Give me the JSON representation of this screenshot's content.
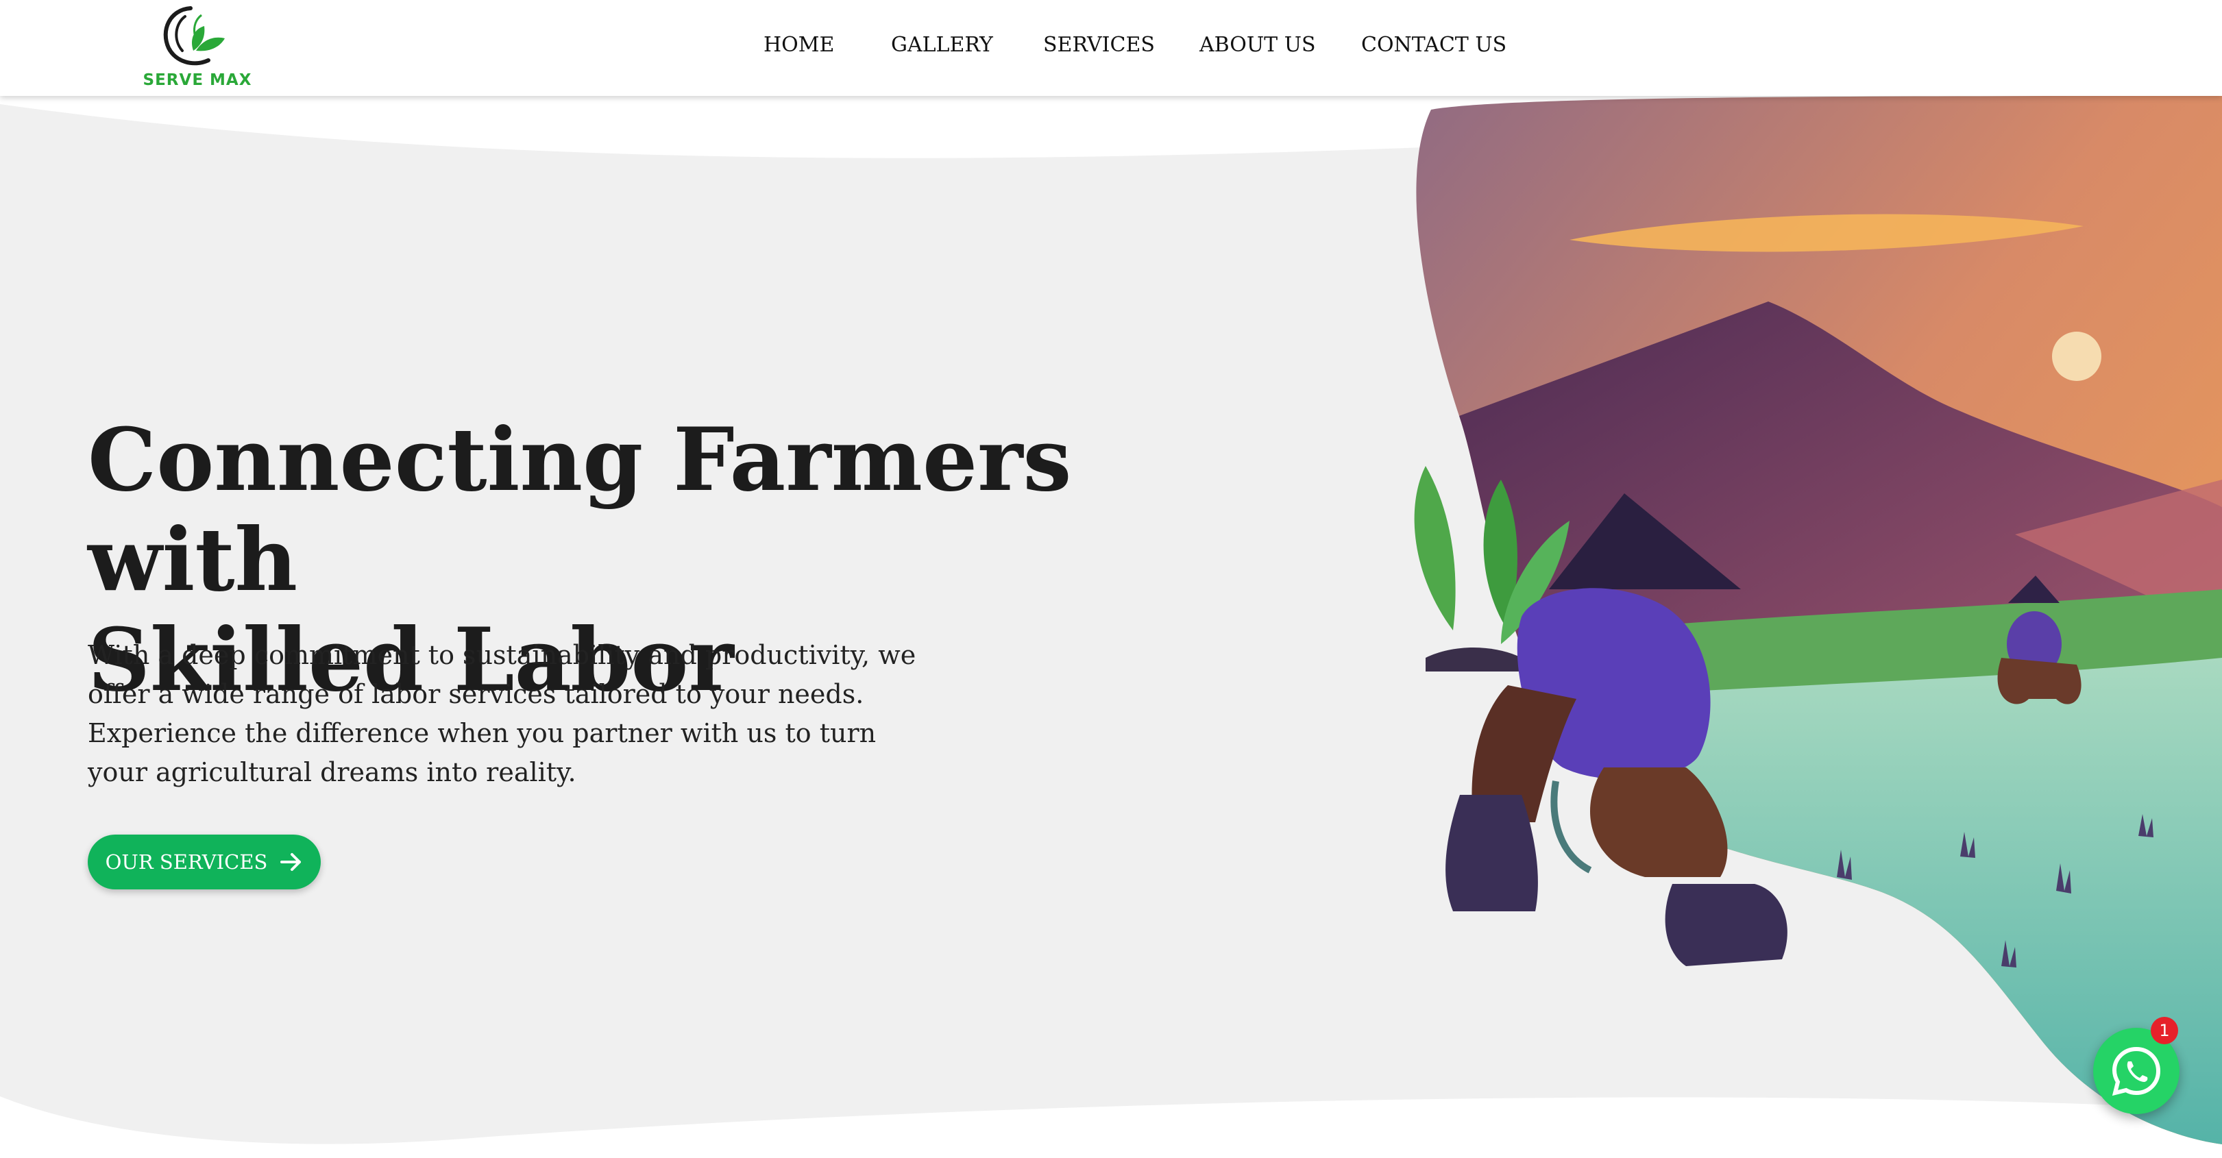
{
  "brand": {
    "name": "SERVE MAX",
    "accent_color": "#10b35a",
    "logo_icon": "leaf-swirl-icon"
  },
  "nav": {
    "items": [
      {
        "label": "HOME"
      },
      {
        "label": "GALLERY"
      },
      {
        "label": "SERVICES"
      },
      {
        "label": "ABOUT US"
      },
      {
        "label": "CONTACT US"
      }
    ]
  },
  "hero": {
    "title_line1": "Connecting Farmers with",
    "title_line2": "Skilled Labor",
    "description": "With a deep commitment to sustainability and productivity, we offer a wide range of labor services tailored to your needs. Experience the difference when you partner with us to turn your agricultural dreams into reality.",
    "cta_label": "OUR SERVICES",
    "cta_icon": "arrow-right-icon",
    "illustration": "farmers-planting-rice-illustration"
  },
  "whatsapp": {
    "icon": "whatsapp-icon",
    "badge_count": "1",
    "color": "#25d366"
  }
}
